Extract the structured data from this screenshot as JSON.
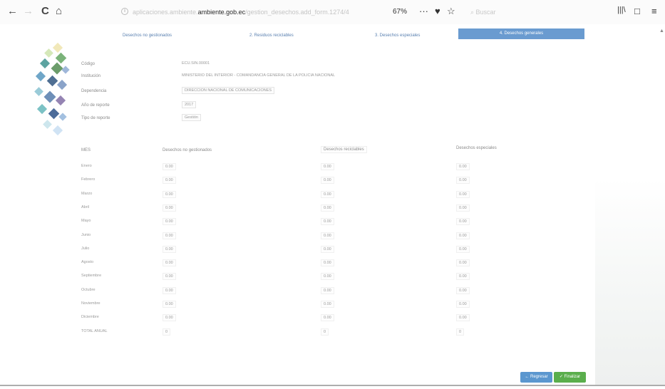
{
  "browser": {
    "back_icon": "←",
    "forward_icon": "→",
    "reload_icon": "C",
    "home_icon": "⌂",
    "url_prefix": "aplicaciones.ambiente.",
    "url_domain": "ambiente.gob.ec",
    "url_suffix": "/gestion_desechos.add_form.1274/4",
    "zoom": "67%",
    "more_icon": "···",
    "pocket_icon": "♥",
    "star_icon": "☆",
    "search_placeholder": "Buscar",
    "library_icon": "|||\\",
    "sidebar_icon": "□",
    "menu_icon": "≡"
  },
  "tabs": [
    {
      "label": "Desechos no gestionados"
    },
    {
      "label": "2. Residuos reciclables"
    },
    {
      "label": "3. Desechos especiales"
    },
    {
      "label": "4. Desechos generales"
    }
  ],
  "form": {
    "codigo_label": "Código",
    "codigo_value": "ECU.SIN.00001",
    "institucion_label": "Institución",
    "institucion_value": "MINISTERIO DEL INTERIOR - COMANDANCIA GENERAL DE LA POLICIA NACIONAL",
    "dependencia_label": "Dependencia",
    "dependencia_value": "DIRECCION NACIONAL DE COMUNICACIONES",
    "anio_label": "Año de reporte",
    "anio_value": "2017",
    "tipo_label": "Tipo de reporte",
    "tipo_value": "Gestión"
  },
  "table": {
    "headers": [
      "MES",
      "Desechos no gestionados",
      "Desechos reciclables",
      "Desechos especiales"
    ],
    "rows": [
      {
        "mes": "Enero",
        "a": "0.00",
        "b": "0.00",
        "c": "0.00"
      },
      {
        "mes": "Febrero",
        "a": "0.00",
        "b": "0.00",
        "c": "0.00"
      },
      {
        "mes": "Marzo",
        "a": "0.00",
        "b": "0.00",
        "c": "0.00"
      },
      {
        "mes": "Abril",
        "a": "0.00",
        "b": "0.00",
        "c": "0.00"
      },
      {
        "mes": "Mayo",
        "a": "0.00",
        "b": "0.00",
        "c": "0.00"
      },
      {
        "mes": "Junio",
        "a": "0.00",
        "b": "0.00",
        "c": "0.00"
      },
      {
        "mes": "Julio",
        "a": "0.00",
        "b": "0.00",
        "c": "0.00"
      },
      {
        "mes": "Agosto",
        "a": "0.00",
        "b": "0.00",
        "c": "0.00"
      },
      {
        "mes": "Septiembre",
        "a": "0.00",
        "b": "0.00",
        "c": "0.00"
      },
      {
        "mes": "Octubre",
        "a": "0.00",
        "b": "0.00",
        "c": "0.00"
      },
      {
        "mes": "Noviembre",
        "a": "0.00",
        "b": "0.00",
        "c": "0.00"
      },
      {
        "mes": "Diciembre",
        "a": "0.00",
        "b": "0.00",
        "c": "0.00"
      },
      {
        "mes": "TOTAL ANUAL",
        "a": "0",
        "b": "0",
        "c": "0"
      }
    ]
  },
  "buttons": {
    "back": "← Regresar",
    "finish": "✓ Finalizar"
  },
  "colors": {
    "accent": "#6a9bd0",
    "back_button": "#5b97cf",
    "finish_button": "#5aae4c"
  }
}
